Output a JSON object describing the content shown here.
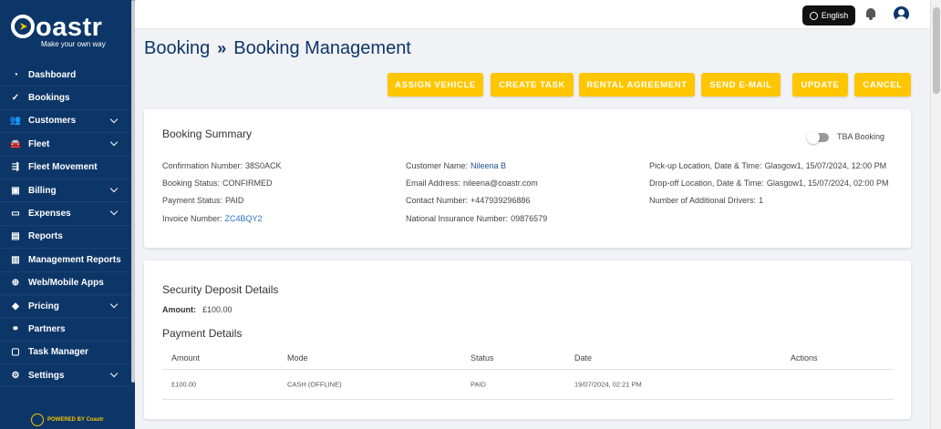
{
  "brand": {
    "name": "oastr",
    "tagline": "Make your own way",
    "powered_by": "POWERED BY Coastr"
  },
  "sidebar": {
    "items": [
      {
        "label": "Dashboard",
        "icon": "gauge-icon",
        "glyph": "◔",
        "expand": false
      },
      {
        "label": "Bookings",
        "icon": "check-circle-icon",
        "glyph": "✓",
        "expand": false
      },
      {
        "label": "Customers",
        "icon": "users-icon",
        "glyph": "👥",
        "expand": true
      },
      {
        "label": "Fleet",
        "icon": "car-icon",
        "glyph": "🚘",
        "expand": true
      },
      {
        "label": "Fleet Movement",
        "icon": "truck-icon",
        "glyph": "⇶",
        "expand": false
      },
      {
        "label": "Billing",
        "icon": "invoice-icon",
        "glyph": "▣",
        "expand": true
      },
      {
        "label": "Expenses",
        "icon": "card-icon",
        "glyph": "▭",
        "expand": true
      },
      {
        "label": "Reports",
        "icon": "report-icon",
        "glyph": "▤",
        "expand": false
      },
      {
        "label": "Management Reports",
        "icon": "chart-icon",
        "glyph": "▥",
        "expand": false
      },
      {
        "label": "Web/Mobile Apps",
        "icon": "globe-icon",
        "glyph": "⊕",
        "expand": false
      },
      {
        "label": "Pricing",
        "icon": "tag-icon",
        "glyph": "◆",
        "expand": true
      },
      {
        "label": "Partners",
        "icon": "handshake-icon",
        "glyph": "⚭",
        "expand": false
      },
      {
        "label": "Task Manager",
        "icon": "calendar-icon",
        "glyph": "▢",
        "expand": false
      },
      {
        "label": "Settings",
        "icon": "gear-icon",
        "glyph": "⚙",
        "expand": true
      }
    ]
  },
  "topbar": {
    "language": "English"
  },
  "breadcrumb": {
    "root": "Booking",
    "separator": "»",
    "current": "Booking Management"
  },
  "actions": {
    "assign_vehicle": "ASSIGN VEHICLE",
    "create_task": "CREATE TASK",
    "rental_agreement": "RENTAL AGREEMENT",
    "send_email": "SEND E-MAIL",
    "update": "UPDATE",
    "cancel": "CANCEL"
  },
  "summary": {
    "title": "Booking Summary",
    "tba_label": "TBA Booking",
    "confirmation_label": "Confirmation Number:",
    "confirmation": "38S0ACK",
    "status_label": "Booking Status:",
    "status": "CONFIRMED",
    "payment_label": "Payment Status:",
    "payment": "PAID",
    "invoice_label": "Invoice Number:",
    "invoice": "ZC4BQY2",
    "customer_label": "Customer Name:",
    "customer": "Nileena B",
    "email_label": "Email Address:",
    "email": "nileena@coastr.com",
    "contact_label": "Contact Number:",
    "contact": "+447939296886",
    "nin_label": "National Insurance Number:",
    "nin": "09876579",
    "pickup_label": "Pick-up Location, Date & Time:",
    "pickup": "Glasgow1, 15/07/2024, 12:00 PM",
    "dropoff_label": "Drop-off Location, Date & Time:",
    "dropoff": "Glasgow1, 15/07/2024, 02:00 PM",
    "drivers_label": "Number of Additional Drivers:",
    "drivers": "1"
  },
  "deposit": {
    "title": "Security Deposit Details",
    "amount_label": "Amount:",
    "amount": "£100.00"
  },
  "payments": {
    "title": "Payment Details",
    "columns": [
      "Amount",
      "Mode",
      "Status",
      "Date",
      "Actions"
    ],
    "rows": [
      {
        "amount": "£100.00",
        "mode": "CASH (OFFLINE)",
        "status": "PAID",
        "date": "19/07/2024, 02:21 PM",
        "actions": ""
      }
    ]
  }
}
